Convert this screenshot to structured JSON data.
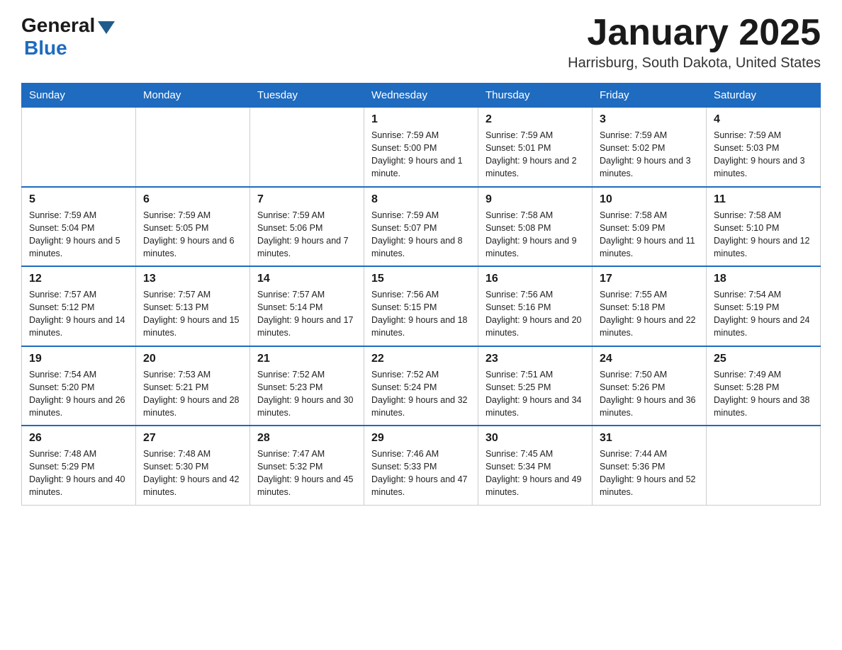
{
  "logo": {
    "general_text": "General",
    "blue_text": "Blue"
  },
  "title": {
    "month_year": "January 2025",
    "location": "Harrisburg, South Dakota, United States"
  },
  "weekdays": [
    "Sunday",
    "Monday",
    "Tuesday",
    "Wednesday",
    "Thursday",
    "Friday",
    "Saturday"
  ],
  "weeks": [
    [
      {
        "day": "",
        "info": ""
      },
      {
        "day": "",
        "info": ""
      },
      {
        "day": "",
        "info": ""
      },
      {
        "day": "1",
        "info": "Sunrise: 7:59 AM\nSunset: 5:00 PM\nDaylight: 9 hours\nand 1 minute."
      },
      {
        "day": "2",
        "info": "Sunrise: 7:59 AM\nSunset: 5:01 PM\nDaylight: 9 hours\nand 2 minutes."
      },
      {
        "day": "3",
        "info": "Sunrise: 7:59 AM\nSunset: 5:02 PM\nDaylight: 9 hours\nand 3 minutes."
      },
      {
        "day": "4",
        "info": "Sunrise: 7:59 AM\nSunset: 5:03 PM\nDaylight: 9 hours\nand 3 minutes."
      }
    ],
    [
      {
        "day": "5",
        "info": "Sunrise: 7:59 AM\nSunset: 5:04 PM\nDaylight: 9 hours\nand 5 minutes."
      },
      {
        "day": "6",
        "info": "Sunrise: 7:59 AM\nSunset: 5:05 PM\nDaylight: 9 hours\nand 6 minutes."
      },
      {
        "day": "7",
        "info": "Sunrise: 7:59 AM\nSunset: 5:06 PM\nDaylight: 9 hours\nand 7 minutes."
      },
      {
        "day": "8",
        "info": "Sunrise: 7:59 AM\nSunset: 5:07 PM\nDaylight: 9 hours\nand 8 minutes."
      },
      {
        "day": "9",
        "info": "Sunrise: 7:58 AM\nSunset: 5:08 PM\nDaylight: 9 hours\nand 9 minutes."
      },
      {
        "day": "10",
        "info": "Sunrise: 7:58 AM\nSunset: 5:09 PM\nDaylight: 9 hours\nand 11 minutes."
      },
      {
        "day": "11",
        "info": "Sunrise: 7:58 AM\nSunset: 5:10 PM\nDaylight: 9 hours\nand 12 minutes."
      }
    ],
    [
      {
        "day": "12",
        "info": "Sunrise: 7:57 AM\nSunset: 5:12 PM\nDaylight: 9 hours\nand 14 minutes."
      },
      {
        "day": "13",
        "info": "Sunrise: 7:57 AM\nSunset: 5:13 PM\nDaylight: 9 hours\nand 15 minutes."
      },
      {
        "day": "14",
        "info": "Sunrise: 7:57 AM\nSunset: 5:14 PM\nDaylight: 9 hours\nand 17 minutes."
      },
      {
        "day": "15",
        "info": "Sunrise: 7:56 AM\nSunset: 5:15 PM\nDaylight: 9 hours\nand 18 minutes."
      },
      {
        "day": "16",
        "info": "Sunrise: 7:56 AM\nSunset: 5:16 PM\nDaylight: 9 hours\nand 20 minutes."
      },
      {
        "day": "17",
        "info": "Sunrise: 7:55 AM\nSunset: 5:18 PM\nDaylight: 9 hours\nand 22 minutes."
      },
      {
        "day": "18",
        "info": "Sunrise: 7:54 AM\nSunset: 5:19 PM\nDaylight: 9 hours\nand 24 minutes."
      }
    ],
    [
      {
        "day": "19",
        "info": "Sunrise: 7:54 AM\nSunset: 5:20 PM\nDaylight: 9 hours\nand 26 minutes."
      },
      {
        "day": "20",
        "info": "Sunrise: 7:53 AM\nSunset: 5:21 PM\nDaylight: 9 hours\nand 28 minutes."
      },
      {
        "day": "21",
        "info": "Sunrise: 7:52 AM\nSunset: 5:23 PM\nDaylight: 9 hours\nand 30 minutes."
      },
      {
        "day": "22",
        "info": "Sunrise: 7:52 AM\nSunset: 5:24 PM\nDaylight: 9 hours\nand 32 minutes."
      },
      {
        "day": "23",
        "info": "Sunrise: 7:51 AM\nSunset: 5:25 PM\nDaylight: 9 hours\nand 34 minutes."
      },
      {
        "day": "24",
        "info": "Sunrise: 7:50 AM\nSunset: 5:26 PM\nDaylight: 9 hours\nand 36 minutes."
      },
      {
        "day": "25",
        "info": "Sunrise: 7:49 AM\nSunset: 5:28 PM\nDaylight: 9 hours\nand 38 minutes."
      }
    ],
    [
      {
        "day": "26",
        "info": "Sunrise: 7:48 AM\nSunset: 5:29 PM\nDaylight: 9 hours\nand 40 minutes."
      },
      {
        "day": "27",
        "info": "Sunrise: 7:48 AM\nSunset: 5:30 PM\nDaylight: 9 hours\nand 42 minutes."
      },
      {
        "day": "28",
        "info": "Sunrise: 7:47 AM\nSunset: 5:32 PM\nDaylight: 9 hours\nand 45 minutes."
      },
      {
        "day": "29",
        "info": "Sunrise: 7:46 AM\nSunset: 5:33 PM\nDaylight: 9 hours\nand 47 minutes."
      },
      {
        "day": "30",
        "info": "Sunrise: 7:45 AM\nSunset: 5:34 PM\nDaylight: 9 hours\nand 49 minutes."
      },
      {
        "day": "31",
        "info": "Sunrise: 7:44 AM\nSunset: 5:36 PM\nDaylight: 9 hours\nand 52 minutes."
      },
      {
        "day": "",
        "info": ""
      }
    ]
  ]
}
